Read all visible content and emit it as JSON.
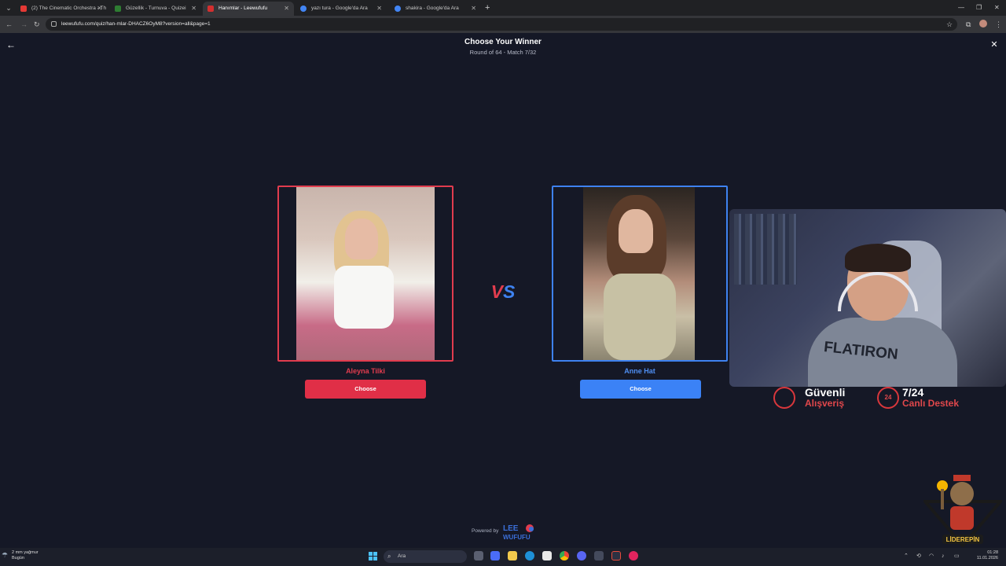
{
  "browser": {
    "tabs": [
      {
        "title": "(2) The Cinematic Orchestra - Th",
        "color": "#e53935",
        "active": false
      },
      {
        "title": "Güzellik - Turnuva - Quizei",
        "color": "#2e7d32",
        "active": false
      },
      {
        "title": "Hanımlar - Leewufufu",
        "color": "#d32f2f",
        "active": true
      },
      {
        "title": "yazı tura - Google'da Ara",
        "color": "#4285f4",
        "active": false
      },
      {
        "title": "shakira - Google'da Ara",
        "color": "#4285f4",
        "active": false
      }
    ],
    "url": "leewufufu.com/quiz/han-mlar-DHACZ6OyM8?version=all&page=1"
  },
  "page": {
    "title": "Choose Your Winner",
    "subtitle": "Round of 64 - Match 7/32",
    "vs_v": "V",
    "vs_s": "S",
    "left": {
      "name": "Aleyna Tilki",
      "button": "Choose",
      "accent": "#e13c4e"
    },
    "right": {
      "name": "Anne Hat",
      "button": "Choose",
      "accent": "#3e82f0"
    },
    "powered_by": "Powered by",
    "logo_line1": "LEE",
    "logo_line2": "WUFUFU"
  },
  "overlay": {
    "shirt_text": "FLATIRON",
    "badge1": {
      "line1": "Güvenli",
      "line2": "Alışveriş"
    },
    "badge2": {
      "line1": "7/24",
      "line2": "Canlı Destek",
      "icon_text": "24"
    },
    "mascot_label": "LİDEREPİN"
  },
  "taskbar": {
    "weather_line1": "2 mm yağmur",
    "weather_line2": "Bugün",
    "search_placeholder": "Ara",
    "time": "01:28",
    "date": "11.01.2026"
  }
}
